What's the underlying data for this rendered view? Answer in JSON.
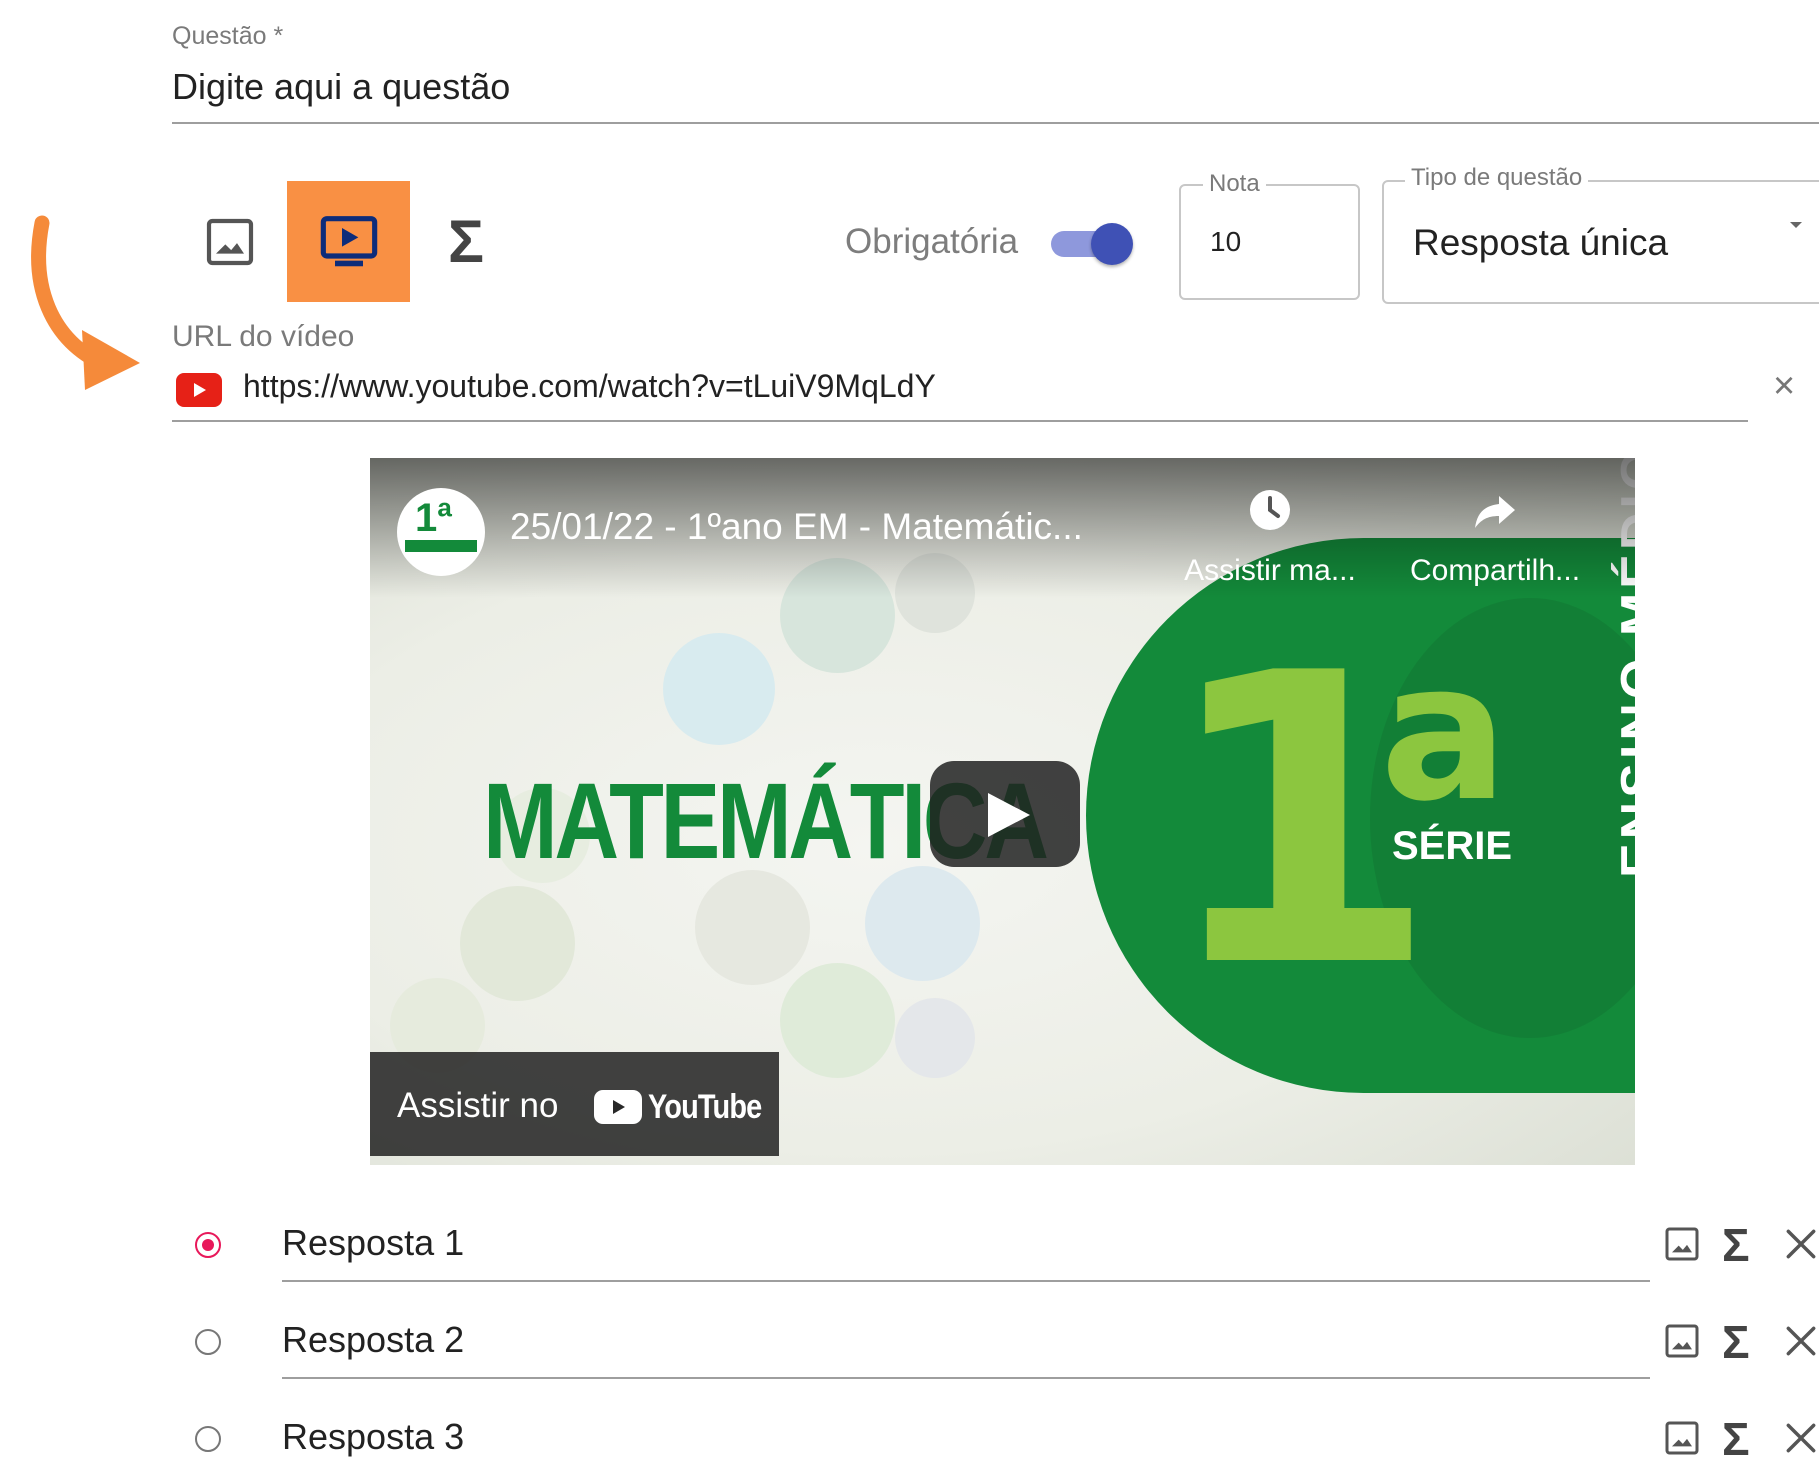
{
  "question": {
    "label": "Questão *",
    "placeholder": "Digite aqui a questão"
  },
  "toolbar": {
    "icons": [
      "image-icon",
      "video-icon",
      "sigma-icon"
    ],
    "highlight_color": "#f99044",
    "sigma_glyph": "Σ"
  },
  "required": {
    "label": "Obrigatória",
    "enabled": true,
    "accent": "#3f51b5"
  },
  "nota": {
    "label": "Nota",
    "value": "10"
  },
  "question_type": {
    "label": "Tipo de questão",
    "value": "Resposta única"
  },
  "video_url": {
    "label": "URL do vídeo",
    "value": "https://www.youtube.com/watch?v=tLuiV9MqLdY",
    "clear": "×"
  },
  "video": {
    "title": "25/01/22 - 1ºano EM - Matemátic...",
    "channel_logo_text": "1ª",
    "watch_later": "Assistir ma...",
    "share": "Compartilh...",
    "thumbnail_subject": "MATEMÁTICA",
    "thumbnail_number": "1",
    "thumbnail_ordinal": "a",
    "thumbnail_serie": "SÉRIE",
    "thumbnail_level": "ENSINO MÉDIO",
    "watch_on": "Assistir no",
    "youtube": "YouTube"
  },
  "answers": [
    {
      "text": "Resposta 1",
      "selected": true
    },
    {
      "text": "Resposta 2",
      "selected": false
    },
    {
      "text": "Resposta 3",
      "selected": false
    }
  ],
  "answer_sigma": "Σ",
  "colors": {
    "radio_selected": "#e8185a",
    "brand_green": "#138a3a",
    "light_green": "#8cc63f",
    "youtube_red": "#e62117"
  }
}
